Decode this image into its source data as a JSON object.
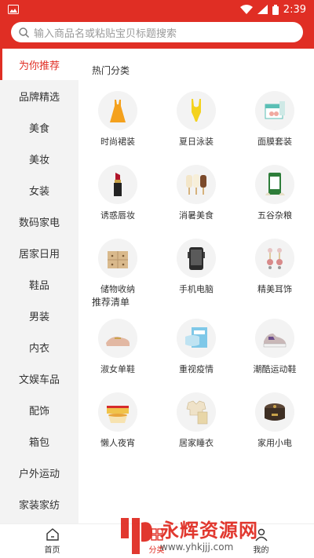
{
  "status_bar": {
    "time": "2:39",
    "icons": [
      "gallery-icon",
      "wifi-icon",
      "signal-icon",
      "battery-icon"
    ]
  },
  "search": {
    "placeholder": "输入商品名或粘贴宝贝标题搜索"
  },
  "sidebar": {
    "active_color": "#e02e24",
    "items": [
      {
        "label": "为你推荐",
        "active": true
      },
      {
        "label": "品牌精选"
      },
      {
        "label": "美食"
      },
      {
        "label": "美妆"
      },
      {
        "label": "女装"
      },
      {
        "label": "数码家电"
      },
      {
        "label": "居家日用"
      },
      {
        "label": "鞋品"
      },
      {
        "label": "男装"
      },
      {
        "label": "内衣"
      },
      {
        "label": "文娱车品"
      },
      {
        "label": "配饰"
      },
      {
        "label": "箱包"
      },
      {
        "label": "户外运动"
      },
      {
        "label": "家装家纺"
      }
    ]
  },
  "hot": {
    "title": "热门分类",
    "items": [
      {
        "label": "时尚裙装",
        "icon": "dress-icon"
      },
      {
        "label": "夏日泳装",
        "icon": "swimsuit-icon"
      },
      {
        "label": "面膜套装",
        "icon": "mask-box-icon"
      },
      {
        "label": "诱惑唇妆",
        "icon": "lipstick-icon"
      },
      {
        "label": "消暑美食",
        "icon": "popsicle-icon"
      },
      {
        "label": "五谷杂粮",
        "icon": "rice-bag-icon"
      },
      {
        "label": "储物收纳",
        "icon": "drawer-icon"
      },
      {
        "label": "手机电脑",
        "icon": "rugged-phone-icon"
      },
      {
        "label": "精美耳饰",
        "icon": "earrings-icon"
      }
    ]
  },
  "recommend": {
    "title": "推荐清单",
    "items": [
      {
        "label": "淑女单鞋",
        "icon": "loafer-icon"
      },
      {
        "label": "重视疫情",
        "icon": "face-mask-icon"
      },
      {
        "label": "潮酷运动鞋",
        "icon": "sneaker-icon"
      },
      {
        "label": "懒人夜宵",
        "icon": "instant-noodle-icon"
      },
      {
        "label": "居家睡衣",
        "icon": "pajama-icon"
      },
      {
        "label": "家用小电",
        "icon": "rice-cooker-icon"
      }
    ]
  },
  "bottom_nav": {
    "items": [
      {
        "label": "首页",
        "icon": "home-icon"
      },
      {
        "label": "分类",
        "icon": "category-icon",
        "active": true
      },
      {
        "label": "我的",
        "icon": "profile-icon"
      }
    ]
  },
  "watermark": {
    "title": "永辉资源网",
    "url": "www.yhkjjj.com"
  }
}
